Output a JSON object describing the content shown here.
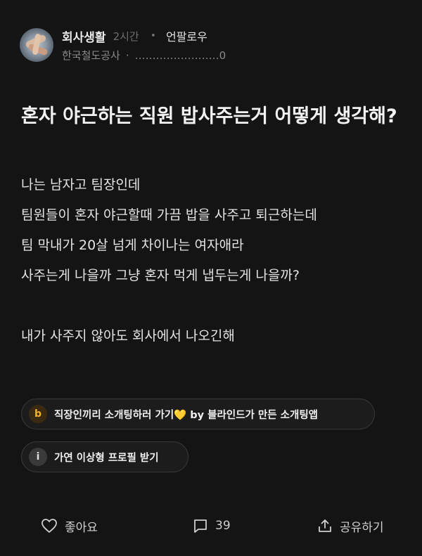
{
  "post": {
    "board": "회사생활",
    "time": "2시간",
    "follow_label": "언팔로우",
    "company": "한국철도공사",
    "author": "……………………0",
    "title": "혼자 야근하는 직원 밥사주는거 어떻게 생각해?",
    "body_lines": [
      "나는 남자고 팀장인데",
      "팀원들이 혼자 야근할때 가끔 밥을 사주고 퇴근하는데",
      "팀 막내가 20살 넘게 차이나는 여자애라",
      "사주는게 나을까 그냥 혼자 먹게 냅두는게 나을까?",
      "",
      "내가 사주지 않아도 회사에서 나오긴해"
    ]
  },
  "chips": {
    "ad": {
      "icon_letter": "b",
      "text": "직장인끼리 소개팅하러 가기",
      "emoji": "💛",
      "suffix": " by 블라인드가 만든 소개팅앱"
    },
    "info": {
      "icon_letter": "i",
      "text": "가연 이상형 프로필 받기"
    }
  },
  "footer": {
    "like_label": "좋아요",
    "comment_count": "39",
    "share_label": "공유하기"
  },
  "colors": {
    "background": "#141414",
    "ad_icon": "#f0b429"
  }
}
